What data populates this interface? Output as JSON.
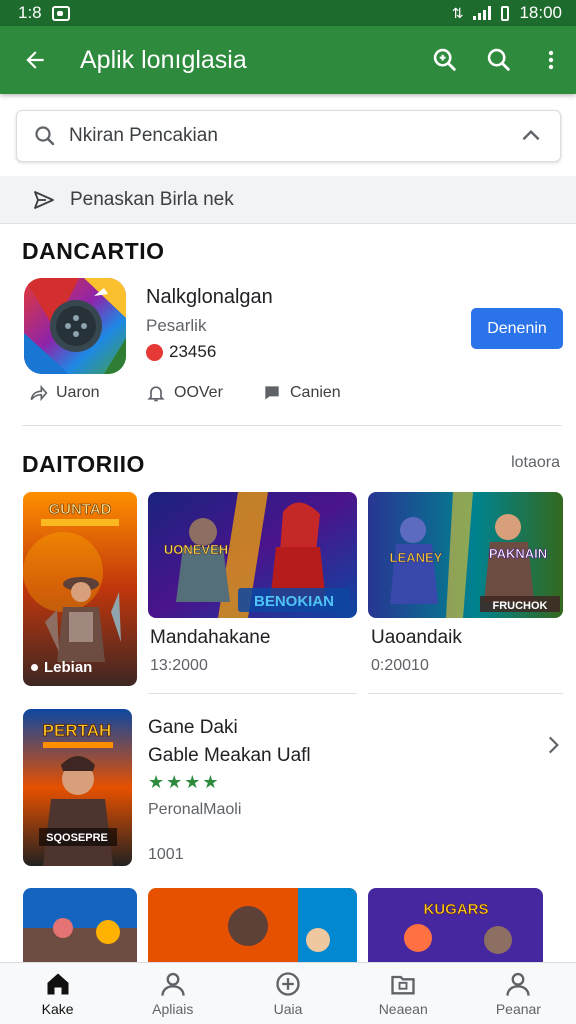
{
  "status": {
    "time": "1:8",
    "clock": "18:00"
  },
  "appbar": {
    "title": "Aplik lonıglasia"
  },
  "search": {
    "placeholder": "Nkiran Pencakian"
  },
  "filter": {
    "label": "Penaskan Birla nek"
  },
  "featured": {
    "heading": "DANCARTIO",
    "app_name": "Nalkglonalgan",
    "sub": "Pesarlik",
    "rating": "23456",
    "button": "Denenin",
    "actions": [
      {
        "label": "Uaron",
        "icon": "share-icon"
      },
      {
        "label": "OOVer",
        "icon": "bell-icon"
      },
      {
        "label": "Canien",
        "icon": "comment-icon"
      }
    ]
  },
  "section2": {
    "heading": "DAITORIIO",
    "more": "lotaora",
    "tiles": [
      {
        "poster_text": "GUNTAD",
        "tag": "Lebian"
      },
      {
        "title_top": "UONEVEH",
        "title_bottom": "BENOKIAN",
        "label": "Mandahakane",
        "count": "13:2000"
      },
      {
        "title_top": "LEANEY",
        "title_right": "PAKNAIN",
        "title_bottom": "FRUCHOK",
        "label": "Uaoandaik",
        "count": "0:20010"
      }
    ]
  },
  "game2": {
    "poster_text": "PERTAH",
    "poster_sub": "SQOSEPRE",
    "title1": "Gane Daki",
    "title2": "Gable Meakan Uafl",
    "stars": "★★★★",
    "publisher": "PeronalMaoli",
    "count": "1001"
  },
  "row3": {
    "tile3_text": "KUGARS"
  },
  "nav": [
    {
      "label": "Kake",
      "icon": "home-icon"
    },
    {
      "label": "Apliais",
      "icon": "person-icon"
    },
    {
      "label": "Uaia",
      "icon": "plus-circle-icon"
    },
    {
      "label": "Neaean",
      "icon": "folder-icon"
    },
    {
      "label": "Peanar",
      "icon": "account-icon"
    }
  ],
  "colors": {
    "appbar": "#2e8b3e",
    "statusbar": "#1e6b2e",
    "button": "#2a73e8"
  }
}
